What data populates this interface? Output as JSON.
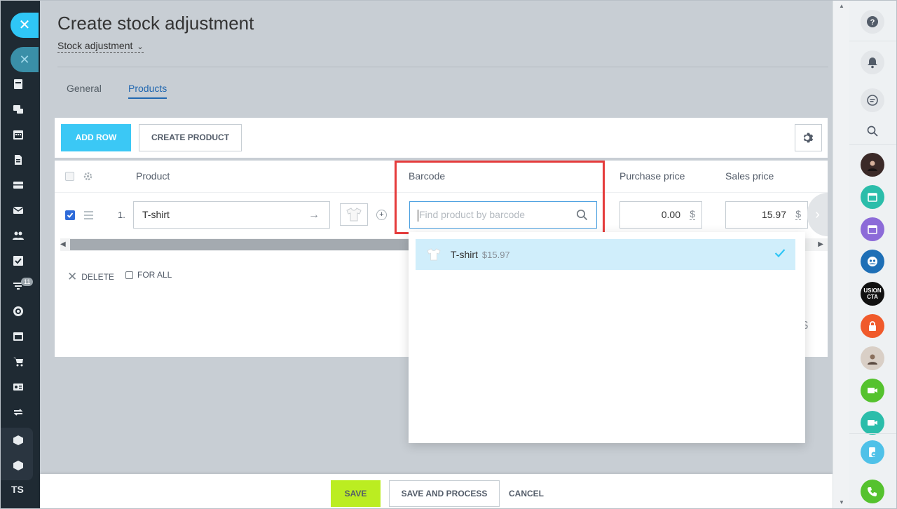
{
  "page": {
    "title": "Create stock adjustment",
    "subtitle": "Stock adjustment"
  },
  "tabs": [
    {
      "label": "General",
      "active": false
    },
    {
      "label": "Products",
      "active": true
    }
  ],
  "toolbar": {
    "add_row": "ADD ROW",
    "create_product": "CREATE PRODUCT"
  },
  "table": {
    "headers": {
      "product": "Product",
      "barcode": "Barcode",
      "purchase_price": "Purchase price",
      "sales_price": "Sales price"
    },
    "rows": [
      {
        "number": "1.",
        "product": "T-shirt",
        "barcode_placeholder": "Find product by barcode",
        "purchase_price": "0.00",
        "sales_price": "15.97",
        "currency": "$",
        "checked": true
      }
    ],
    "actions": {
      "delete": "DELETE",
      "for_all": "FOR ALL"
    },
    "stray_currency": "$"
  },
  "dropdown": {
    "items": [
      {
        "name": "T-shirt",
        "price": "$15.97",
        "selected": true
      }
    ]
  },
  "footer": {
    "save": "SAVE",
    "save_and_process": "SAVE AND PROCESS",
    "cancel": "CANCEL"
  },
  "left_sidebar": {
    "badge_count": "11",
    "user_initials": "TS",
    "icons": [
      "news-icon",
      "chat-icon",
      "calendar-icon",
      "document-icon",
      "drive-icon",
      "mail-icon",
      "groups-icon",
      "tasks-icon",
      "filter-icon",
      "target-icon",
      "browser-icon",
      "cart-icon",
      "contacts-icon",
      "sync-icon",
      "box-icon",
      "box-icon"
    ]
  },
  "right_panel": {
    "tile_text": "USION CTA"
  },
  "colors": {
    "accent": "#3bc8f5",
    "save": "#bbed21",
    "highlight": "#e53b3b",
    "link": "#2067b0"
  }
}
